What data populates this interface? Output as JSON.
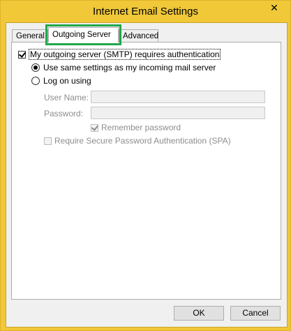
{
  "window": {
    "title": "Internet Email Settings",
    "close_glyph": "✕"
  },
  "tabs": [
    {
      "label": "General",
      "active": false
    },
    {
      "label": "Outgoing Server",
      "active": true
    },
    {
      "label": "Advanced",
      "active": false
    }
  ],
  "outgoing": {
    "requires_auth": {
      "label": "My outgoing server (SMTP) requires authentication",
      "checked": true
    },
    "use_same": {
      "label": "Use same settings as my incoming mail server",
      "selected": true
    },
    "log_on_using": {
      "label": "Log on using",
      "selected": false
    },
    "user_name": {
      "label": "User Name:",
      "value": ""
    },
    "password": {
      "label": "Password:",
      "value": ""
    },
    "remember_password": {
      "label": "Remember password",
      "checked": true,
      "disabled": true
    },
    "require_spa": {
      "label": "Require Secure Password Authentication (SPA)",
      "checked": false,
      "disabled": true
    }
  },
  "buttons": {
    "ok": "OK",
    "cancel": "Cancel"
  },
  "colors": {
    "frame": "#f0c838",
    "highlight_outline": "#1fa84a"
  }
}
